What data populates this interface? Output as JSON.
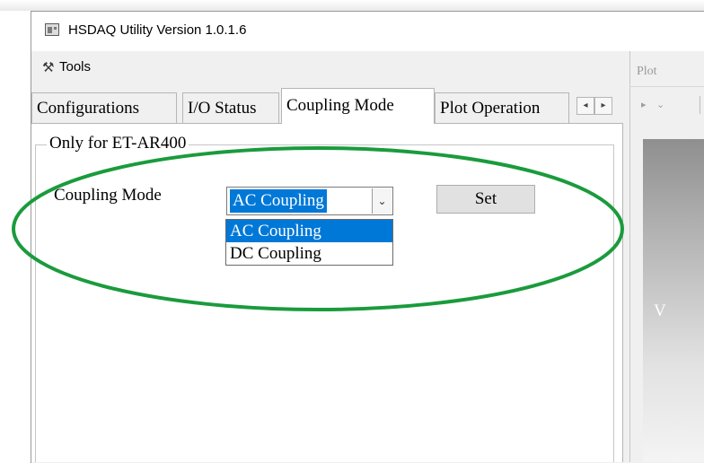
{
  "window": {
    "title": "HSDAQ Utility Version 1.0.1.6"
  },
  "menu": {
    "tools_label": "Tools",
    "tools_icon": "tools-icon"
  },
  "tabs": [
    {
      "label": "Configurations",
      "selected": false
    },
    {
      "label": "I/O Status",
      "selected": false
    },
    {
      "label": "Coupling Mode",
      "selected": true
    },
    {
      "label": "Plot Operation",
      "selected": false
    }
  ],
  "tab_scroll": {
    "left_glyph": "◂",
    "right_glyph": "▸"
  },
  "group": {
    "title": "Only for ET-AR400"
  },
  "coupling": {
    "label": "Coupling Mode",
    "selected_value": "AC Coupling",
    "options": [
      "AC Coupling",
      "DC Coupling"
    ],
    "highlighted_option": "AC Coupling",
    "set_button_label": "Set",
    "dropdown_glyph": "⌄"
  },
  "plot_panel": {
    "label": "Plot",
    "toolbar_glyphs": "▸ ⌄",
    "y_axis_label": "V"
  },
  "colors": {
    "selection": "#0078d7",
    "annotation": "#1a9b3c",
    "window_bg": "#f0f0f0"
  }
}
